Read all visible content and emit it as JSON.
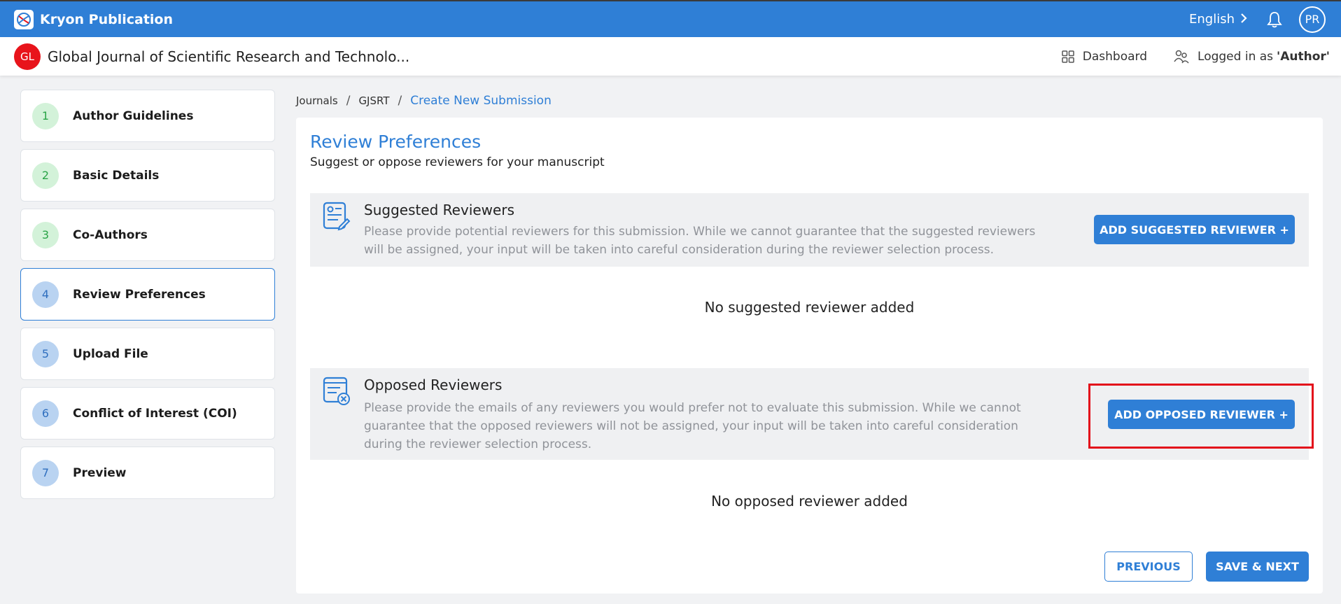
{
  "app": {
    "name": "Kryon Publication"
  },
  "topbar": {
    "language": "English",
    "avatar_initials": "PR",
    "icons": [
      "kryon-logo-icon",
      "chevron-right-icon",
      "bell-icon"
    ]
  },
  "subbar": {
    "journal_badge": "GL",
    "journal_title": "Global Journal of Scientific Research and Technolo...",
    "dashboard_label": "Dashboard",
    "logged_in_prefix": "Logged in as",
    "logged_in_role": "'Author'",
    "icons": [
      "dashboard-grid-icon",
      "users-icon"
    ]
  },
  "sidebar": {
    "steps": [
      {
        "number": "1",
        "label": "Author Guidelines",
        "status": "done"
      },
      {
        "number": "2",
        "label": "Basic Details",
        "status": "done"
      },
      {
        "number": "3",
        "label": "Co-Authors",
        "status": "done"
      },
      {
        "number": "4",
        "label": "Review Preferences",
        "status": "active"
      },
      {
        "number": "5",
        "label": "Upload File",
        "status": "todo"
      },
      {
        "number": "6",
        "label": "Conflict of Interest (COI)",
        "status": "todo"
      },
      {
        "number": "7",
        "label": "Preview",
        "status": "todo"
      }
    ]
  },
  "breadcrumb": {
    "items": [
      "Journals",
      "GJSRT"
    ],
    "separator": "/",
    "current": "Create New Submission"
  },
  "main": {
    "title": "Review Preferences",
    "subtitle": "Suggest or oppose reviewers for your manuscript",
    "suggested": {
      "title": "Suggested Reviewers",
      "description": "Please provide potential reviewers for this submission. While we cannot guarantee that the suggested reviewers will be assigned, your input will be taken into careful consideration during the reviewer selection process.",
      "button": "ADD SUGGESTED REVIEWER +",
      "empty": "No suggested reviewer added",
      "icon": "reviewer-edit-icon"
    },
    "opposed": {
      "title": "Opposed Reviewers",
      "description": "Please provide the emails of any reviewers you would prefer not to evaluate this submission. While we cannot guarantee that the opposed reviewers will not be assigned, your input will be taken into careful consideration during the reviewer selection process.",
      "button": "ADD OPPOSED REVIEWER +",
      "empty": "No opposed reviewer added",
      "icon": "reviewer-remove-icon"
    },
    "previous_button": "PREVIOUS",
    "next_button": "SAVE & NEXT"
  },
  "colors": {
    "primary": "#2f7fd6",
    "badge_red": "#e8141b",
    "highlight": "#e3101b",
    "done_green": "#2aa447"
  }
}
